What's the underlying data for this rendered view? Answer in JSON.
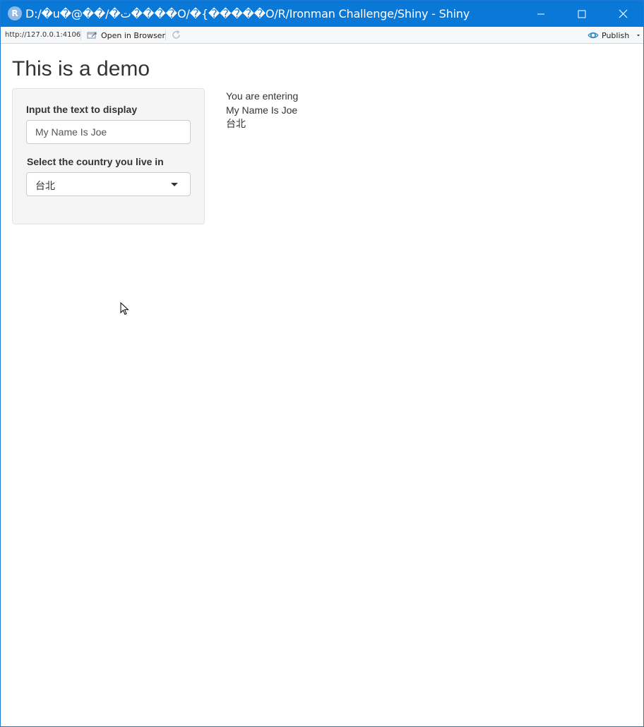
{
  "window": {
    "title": "D:/�u�@��/�ت����O/�{�����O/R/Ironman Challenge/Shiny - Shiny",
    "logo_letter": "R"
  },
  "toolbar": {
    "url": "http://127.0.0.1:4106",
    "open_in_browser": "Open in Browser",
    "publish": "Publish"
  },
  "page": {
    "title": "This is a demo"
  },
  "sidebar": {
    "text_input": {
      "label": "Input the text to display",
      "value": "My Name Is Joe"
    },
    "country_select": {
      "label": "Select the country you live in",
      "selected": "台北"
    }
  },
  "output": {
    "heading": "You are entering",
    "text_value": "My Name Is Joe",
    "country_value": "台北"
  },
  "colors": {
    "titlebar": "#0a78d7",
    "well_bg": "#f5f5f5",
    "text": "#333333"
  }
}
